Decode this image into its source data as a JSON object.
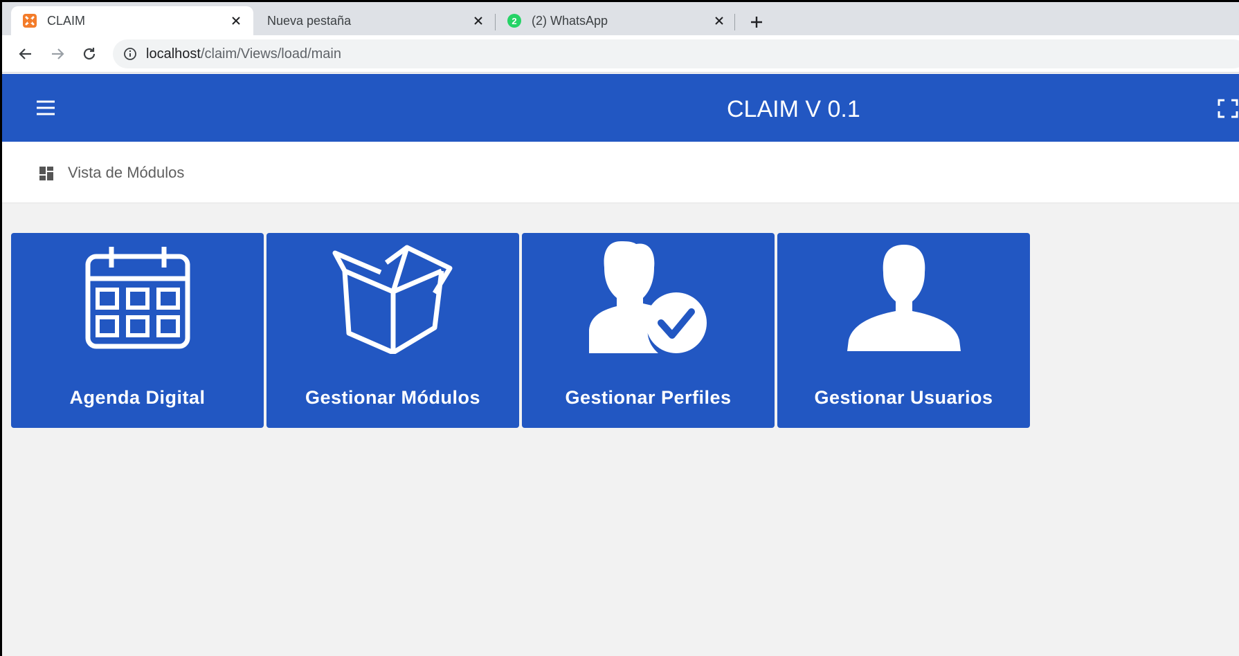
{
  "browser": {
    "tabs": [
      {
        "title": "CLAIM",
        "favicon": "xampp-icon",
        "active": true
      },
      {
        "title": "Nueva pestaña",
        "favicon": "",
        "active": false
      },
      {
        "title": "(2) WhatsApp",
        "favicon": "whatsapp-icon",
        "badge": "2",
        "active": false
      }
    ],
    "url_host": "localhost",
    "url_path": "/claim/Views/load/main"
  },
  "header": {
    "title": "CLAIM V 0.1",
    "background": "#2257c2"
  },
  "breadcrumb": {
    "icon": "dashboard-icon",
    "label": "Vista de Módulos"
  },
  "modules": [
    {
      "label": "Agenda Digital",
      "icon": "calendar-icon"
    },
    {
      "label": "Gestionar Módulos",
      "icon": "open-box-icon"
    },
    {
      "label": "Gestionar Perfiles",
      "icon": "user-check-icon"
    },
    {
      "label": "Gestionar Usuarios",
      "icon": "user-icon"
    }
  ]
}
